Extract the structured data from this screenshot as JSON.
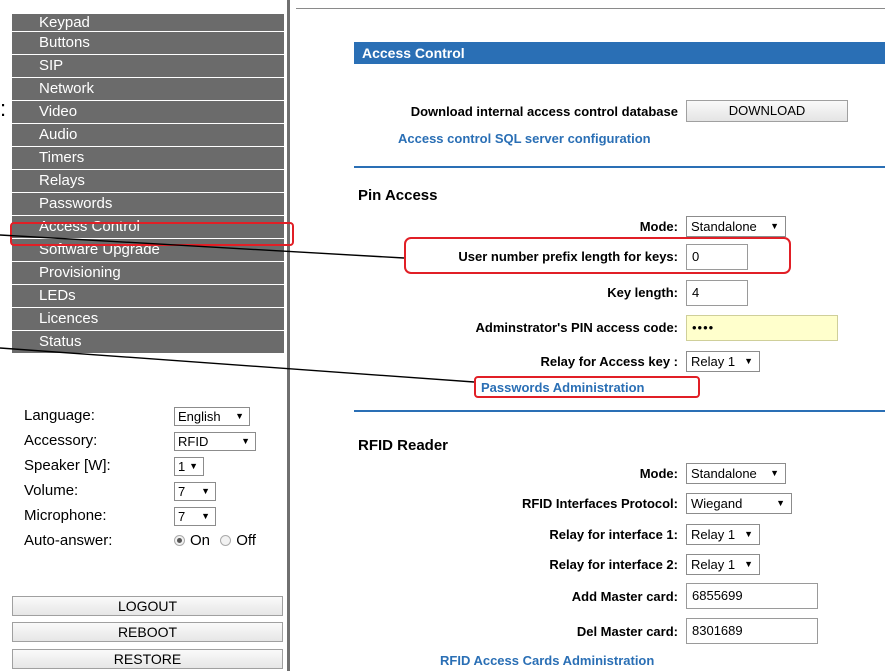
{
  "nav": {
    "items": [
      "Keypad",
      "Buttons",
      "SIP",
      "Network",
      "Video",
      "Audio",
      "Timers",
      "Relays",
      "Passwords",
      "Access Control",
      "Software Upgrade",
      "Provisioning",
      "LEDs",
      "Licences",
      "Status"
    ]
  },
  "settings": {
    "language": {
      "label": "Language:",
      "value": "English"
    },
    "accessory": {
      "label": "Accessory:",
      "value": "RFID"
    },
    "speaker": {
      "label": "Speaker [W]:",
      "value": "1"
    },
    "volume": {
      "label": "Volume:",
      "value": "7"
    },
    "microphone": {
      "label": "Microphone:",
      "value": "7"
    },
    "auto_answer": {
      "label": "Auto-answer:",
      "on": "On",
      "off": "Off",
      "selected": "On"
    }
  },
  "buttons": {
    "logout": "LOGOUT",
    "reboot": "REBOOT",
    "restore": "RESTORE"
  },
  "main": {
    "title": "Access Control",
    "download_label": "Download internal access control database",
    "download_button": "DOWNLOAD",
    "sql_link": "Access control SQL server configuration",
    "pin": {
      "heading": "Pin Access",
      "mode_label": "Mode:",
      "mode_value": "Standalone",
      "prefix_label": "User number prefix length for keys:",
      "prefix_value": "0",
      "keylen_label": "Key length:",
      "keylen_value": "4",
      "admin_label": "Adminstrator's PIN access code:",
      "admin_value": "••••",
      "relay_label": "Relay for Access key :",
      "relay_value": "Relay 1",
      "passwords_link": "Passwords Administration"
    },
    "rfid": {
      "heading": "RFID Reader",
      "mode_label": "Mode:",
      "mode_value": "Standalone",
      "protocol_label": "RFID Interfaces Protocol:",
      "protocol_value": "Wiegand",
      "relay1_label": "Relay for interface 1:",
      "relay1_value": "Relay 1",
      "relay2_label": "Relay for interface 2:",
      "relay2_value": "Relay 1",
      "add_master_label": "Add Master card:",
      "add_master_value": "6855699",
      "del_master_label": "Del Master card:",
      "del_master_value": "8301689",
      "cards_link": "RFID Access Cards Administration"
    }
  },
  "colors": {
    "accent": "#2a6fb5",
    "highlight": "#e11f26",
    "nav_bg": "#6b6b6b"
  }
}
